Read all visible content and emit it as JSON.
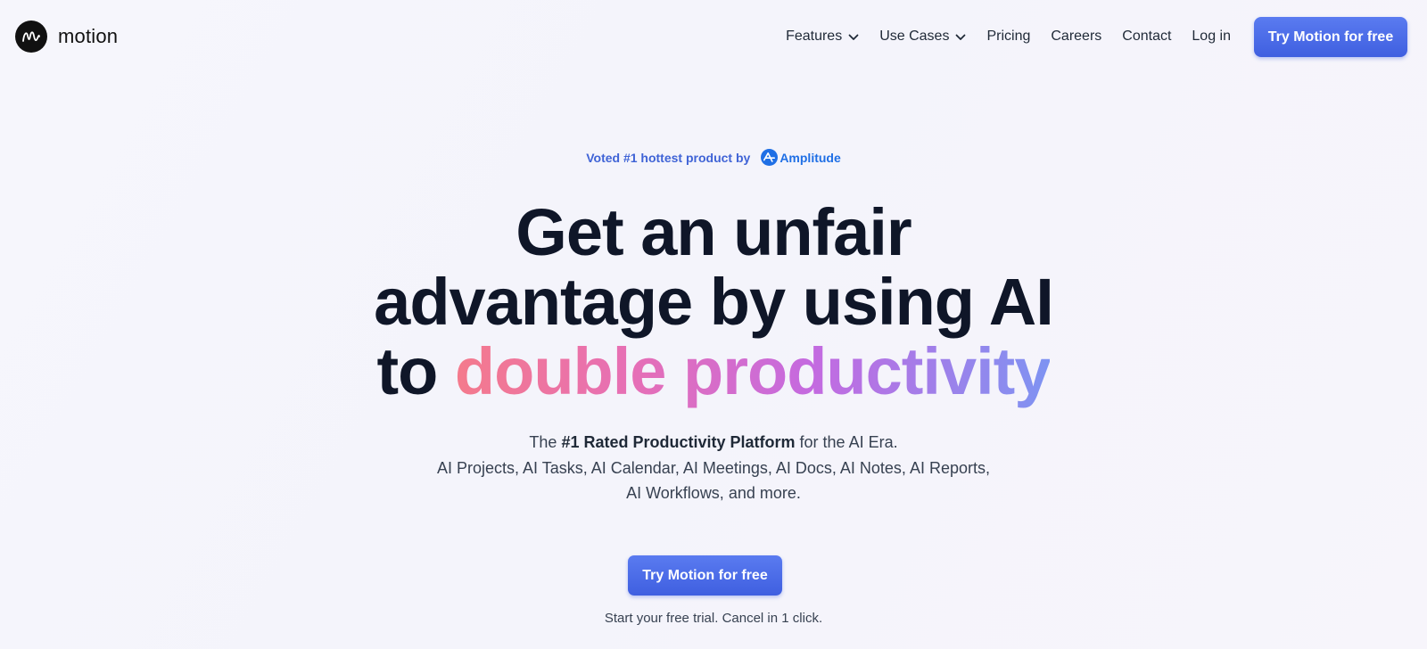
{
  "brand": {
    "name": "motion",
    "logo_icon": "motion-m-logo"
  },
  "nav": {
    "links": [
      {
        "label": "Features",
        "has_dropdown": true
      },
      {
        "label": "Use Cases",
        "has_dropdown": true
      },
      {
        "label": "Pricing"
      },
      {
        "label": "Careers"
      },
      {
        "label": "Contact"
      },
      {
        "label": "Log in"
      }
    ],
    "cta_label": "Try Motion for free"
  },
  "hero": {
    "voted_text": "Voted #1 hottest product by",
    "voted_brand": "Amplitude",
    "headline_line1": "Get an unfair",
    "headline_line2": "advantage by using AI",
    "headline_prefix": "to",
    "headline_highlight": "double productivity",
    "sub_prefix": "The",
    "sub_bold": "#1 Rated Productivity Platform",
    "sub_suffix": "for the AI Era.",
    "sub_line2": "AI Projects, AI Tasks, AI Calendar, AI Meetings, AI Docs, AI Notes, AI Reports,",
    "sub_line3": "AI Workflows, and more.",
    "cta_label": "Try Motion for free",
    "trial_note": "Start your free trial. Cancel in 1 click."
  },
  "colors": {
    "accent": "#4a6ae6",
    "text_dark": "#0f1628",
    "voted_blue": "#3f63d6",
    "amplitude_blue": "#1f6fe5"
  }
}
